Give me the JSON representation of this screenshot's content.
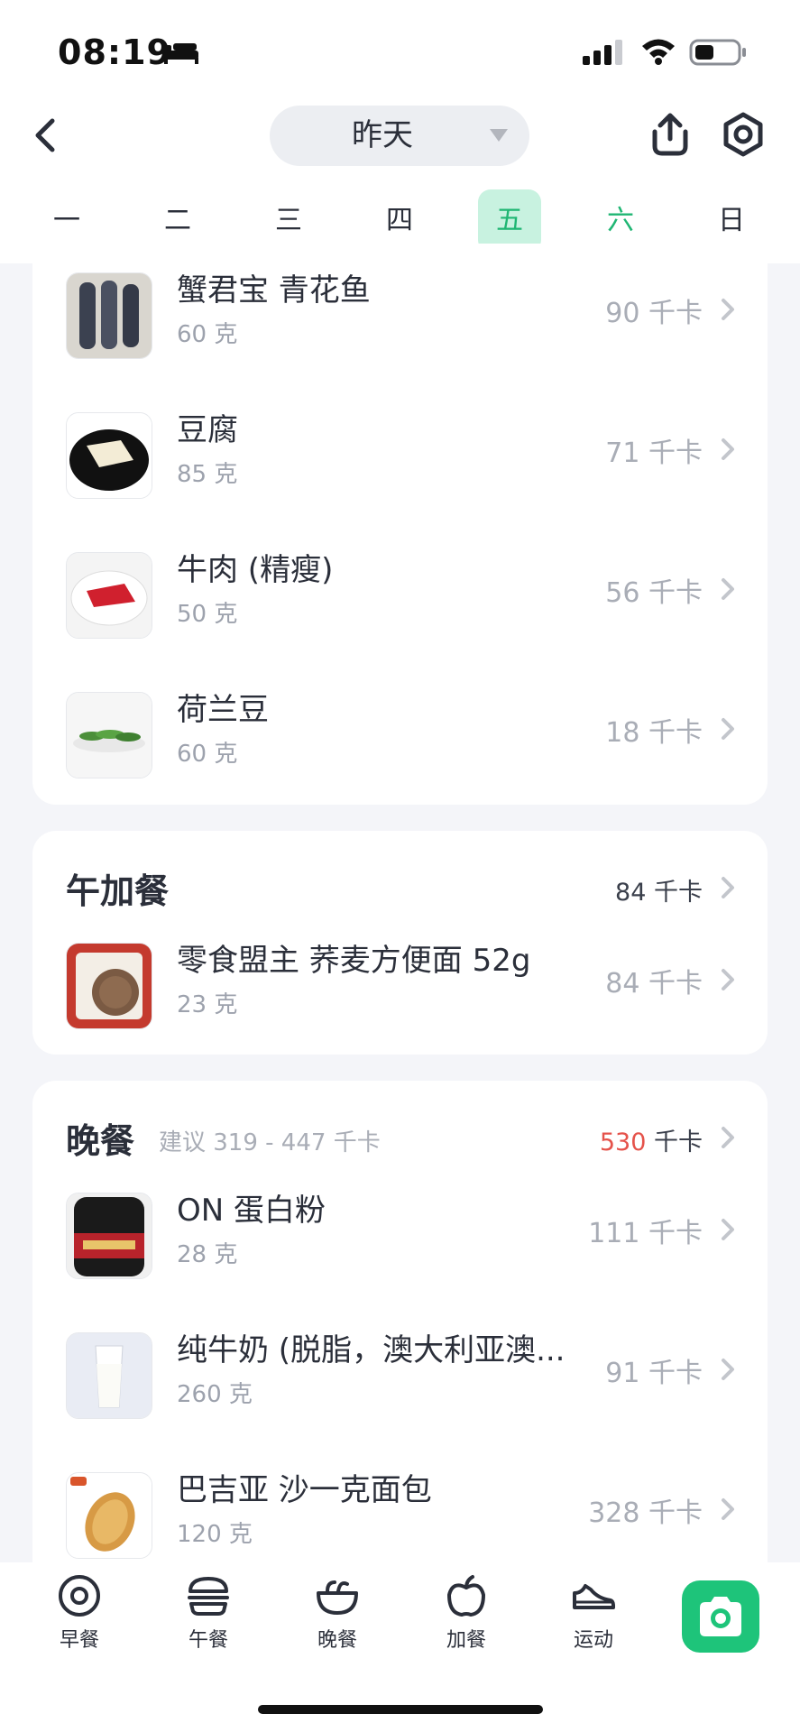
{
  "status": {
    "time": "08:19"
  },
  "header": {
    "day_label": "昨天"
  },
  "week": {
    "days": [
      "一",
      "二",
      "三",
      "四",
      "五",
      "六",
      "日"
    ]
  },
  "meals": {
    "lunch_items": [
      {
        "name": "蟹君宝 青花鱼",
        "amount": "60 克",
        "kcal": "90 千卡"
      },
      {
        "name": "豆腐",
        "amount": "85 克",
        "kcal": "71 千卡"
      },
      {
        "name": "牛肉 (精瘦)",
        "amount": "50 克",
        "kcal": "56 千卡"
      },
      {
        "name": "荷兰豆",
        "amount": "60 克",
        "kcal": "18 千卡"
      }
    ],
    "afternoon_snack": {
      "title": "午加餐",
      "total_kcal": "84 千卡",
      "items": [
        {
          "name": "零食盟主 荞麦方便面 52g",
          "amount": "23 克",
          "kcal": "84 千卡"
        }
      ]
    },
    "dinner": {
      "title": "晚餐",
      "hint": "建议 319 - 447 千卡",
      "total_value": "530",
      "total_unit": " 千卡",
      "items": [
        {
          "name": "ON 蛋白粉",
          "amount": "28 克",
          "kcal": "111 千卡"
        },
        {
          "name": "纯牛奶 (脱脂，澳大利亚澳...",
          "amount": "260 克",
          "kcal": "91 千卡"
        },
        {
          "name": "巴吉亚 沙一克面包",
          "amount": "120 克",
          "kcal": "328 千卡"
        }
      ]
    }
  },
  "tabbar": {
    "tabs": [
      {
        "label": "早餐",
        "icon": "breakfast-icon"
      },
      {
        "label": "午餐",
        "icon": "burger-icon"
      },
      {
        "label": "晚餐",
        "icon": "bowl-icon"
      },
      {
        "label": "加餐",
        "icon": "apple-icon"
      },
      {
        "label": "运动",
        "icon": "shoe-icon"
      }
    ],
    "camera_icon": "camera-icon"
  },
  "colors": {
    "accent": "#1ec47a",
    "accent_light": "#c8f2e0",
    "over_budget": "#e5534b"
  }
}
